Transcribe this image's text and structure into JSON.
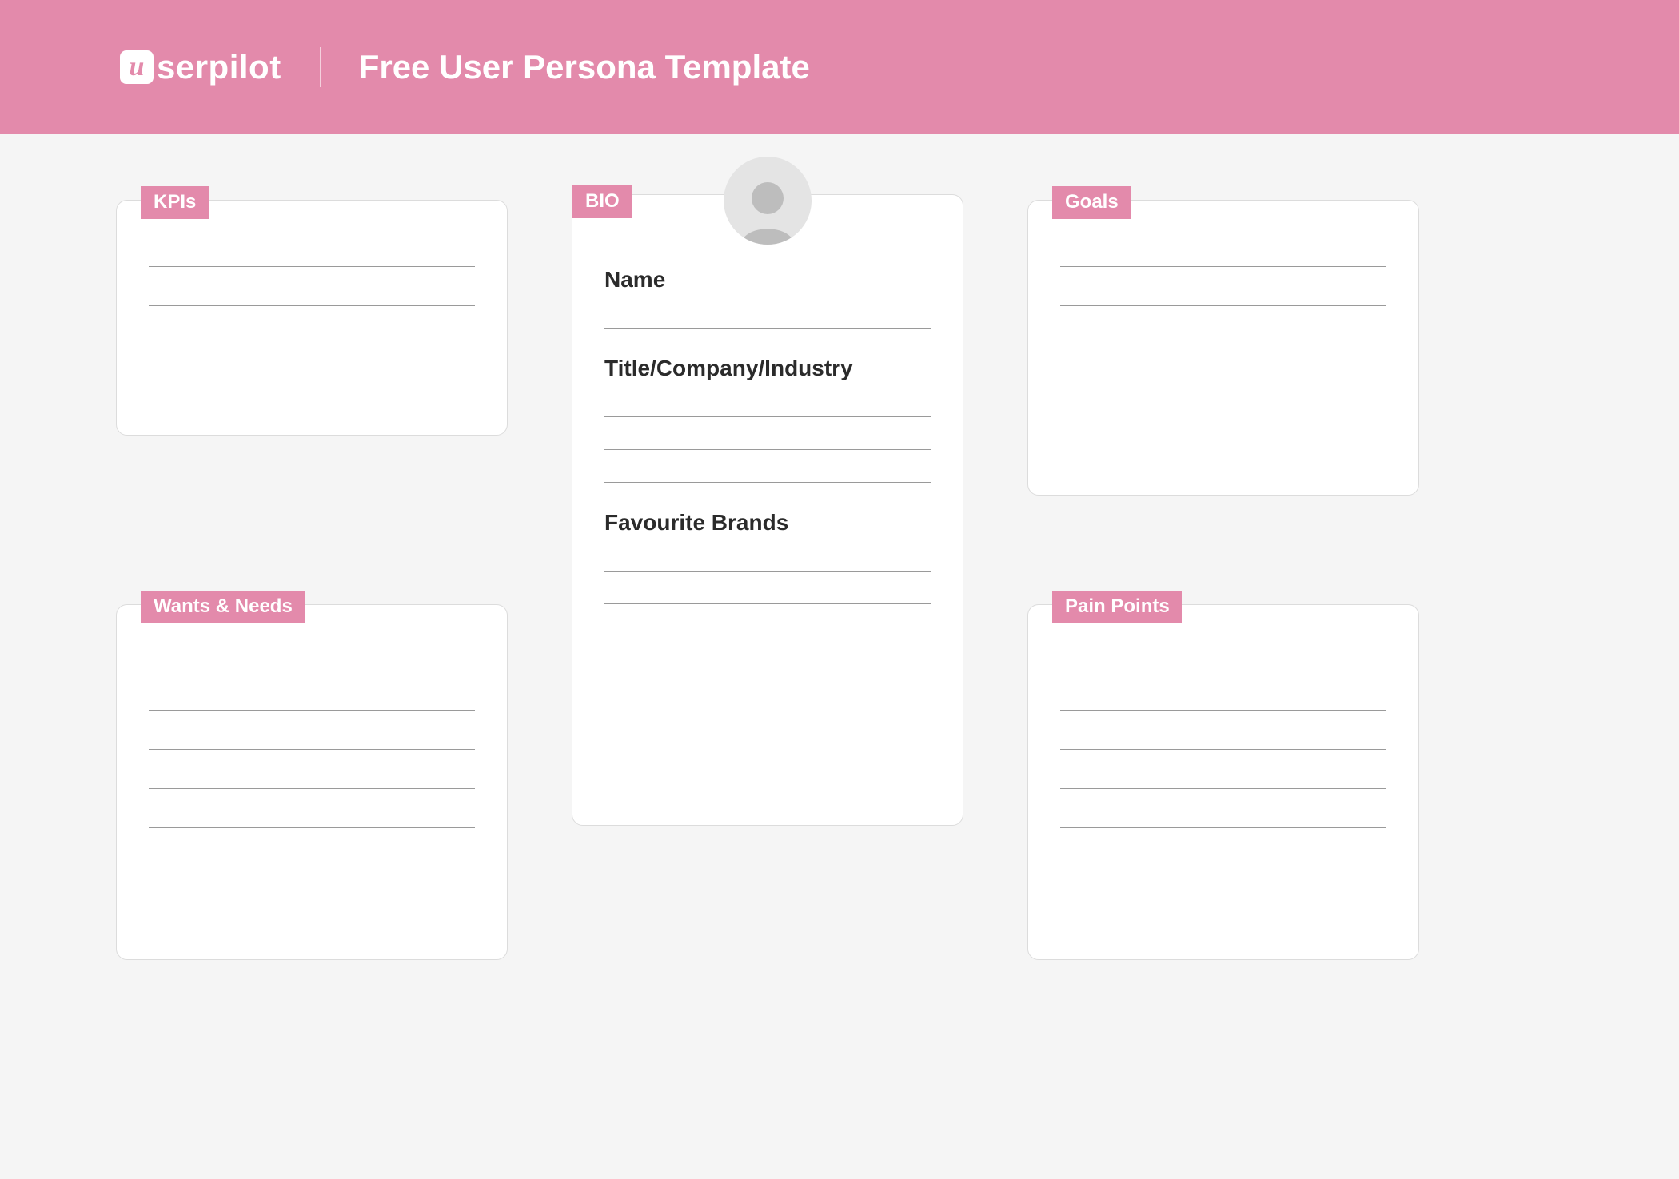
{
  "header": {
    "logo_text": "serpilot",
    "logo_mark_letter": "u",
    "title": "Free User Persona Template"
  },
  "cards": {
    "kpis": {
      "label": "KPIs",
      "lines": 3
    },
    "wants": {
      "label": "Wants & Needs",
      "lines": 5
    },
    "goals": {
      "label": "Goals",
      "lines": 4
    },
    "pains": {
      "label": "Pain Points",
      "lines": 5
    },
    "bio": {
      "label": "BIO",
      "fields": {
        "name": "Name",
        "title": "Title/Company/Industry",
        "brands": "Favourite Brands"
      }
    }
  }
}
